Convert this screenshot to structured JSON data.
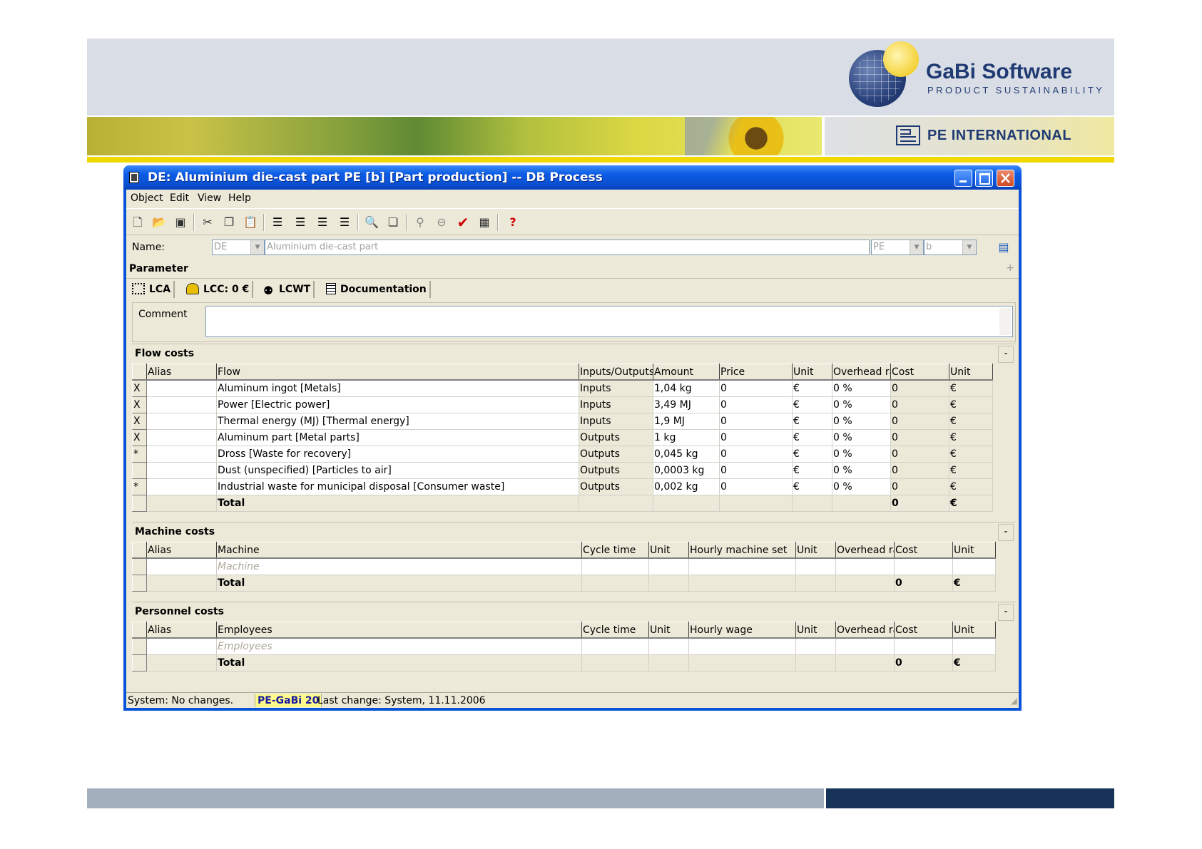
{
  "branding": {
    "logo_title": "GaBi Software",
    "logo_subtitle": "PRODUCT SUSTAINABILITY",
    "company": "PE INTERNATIONAL"
  },
  "window": {
    "title": "DE: Aluminium die-cast part PE [b] [Part production] -- DB Process"
  },
  "menu": {
    "object": "Object",
    "edit": "Edit",
    "view": "View",
    "help": "Help"
  },
  "name_row": {
    "label": "Name:",
    "country": "DE",
    "name": "Aluminium die-cast part",
    "source": "PE",
    "variant": "b"
  },
  "parameter": {
    "label": "Parameter"
  },
  "tabs": {
    "lca": "LCA",
    "lcc": "LCC: 0 €",
    "lcwt": "LCWT",
    "documentation": "Documentation"
  },
  "comment": {
    "label": "Comment",
    "value": ""
  },
  "flow_costs": {
    "title": "Flow costs",
    "headers": [
      "",
      "Alias",
      "Flow",
      "Inputs/Outputs",
      "Amount",
      "Price",
      "Unit",
      "Overhead ra",
      "Cost",
      "Unit"
    ],
    "rows": [
      {
        "mark": "X",
        "alias": "",
        "flow": "Aluminum ingot [Metals]",
        "io": "Inputs",
        "amount": "1,04 kg",
        "price": "0",
        "unit": "€",
        "overhead": "0 %",
        "cost": "0",
        "cost_unit": "€"
      },
      {
        "mark": "X",
        "alias": "",
        "flow": "Power [Electric power]",
        "io": "Inputs",
        "amount": "3,49 MJ",
        "price": "0",
        "unit": "€",
        "overhead": "0 %",
        "cost": "0",
        "cost_unit": "€"
      },
      {
        "mark": "X",
        "alias": "",
        "flow": "Thermal energy (MJ) [Thermal energy]",
        "io": "Inputs",
        "amount": "1,9 MJ",
        "price": "0",
        "unit": "€",
        "overhead": "0 %",
        "cost": "0",
        "cost_unit": "€"
      },
      {
        "mark": "X",
        "alias": "",
        "flow": "Aluminum part [Metal parts]",
        "io": "Outputs",
        "amount": "1 kg",
        "price": "0",
        "unit": "€",
        "overhead": "0 %",
        "cost": "0",
        "cost_unit": "€"
      },
      {
        "mark": "*",
        "alias": "",
        "flow": "Dross [Waste for recovery]",
        "io": "Outputs",
        "amount": "0,045 kg",
        "price": "0",
        "unit": "€",
        "overhead": "0 %",
        "cost": "0",
        "cost_unit": "€"
      },
      {
        "mark": "",
        "alias": "",
        "flow": "Dust (unspecified) [Particles to air]",
        "io": "Outputs",
        "amount": "0,0003 kg",
        "price": "0",
        "unit": "€",
        "overhead": "0 %",
        "cost": "0",
        "cost_unit": "€"
      },
      {
        "mark": "*",
        "alias": "",
        "flow": "Industrial waste for municipal disposal [Consumer waste]",
        "io": "Outputs",
        "amount": "0,002 kg",
        "price": "0",
        "unit": "€",
        "overhead": "0 %",
        "cost": "0",
        "cost_unit": "€"
      }
    ],
    "total": {
      "label": "Total",
      "cost": "0",
      "cost_unit": "€"
    }
  },
  "machine_costs": {
    "title": "Machine costs",
    "headers": [
      "",
      "Alias",
      "Machine",
      "Cycle time",
      "Unit",
      "Hourly machine set",
      "Unit",
      "Overhead ra",
      "Cost",
      "Unit"
    ],
    "placeholder": "Machine",
    "total": {
      "label": "Total",
      "cost": "0",
      "cost_unit": "€"
    }
  },
  "personnel_costs": {
    "title": "Personnel costs",
    "headers": [
      "",
      "Alias",
      "Employees",
      "Cycle time",
      "Unit",
      "Hourly wage",
      "Unit",
      "Overhead ra",
      "Cost",
      "Unit"
    ],
    "placeholder": "Employees",
    "total": {
      "label": "Total",
      "cost": "0",
      "cost_unit": "€"
    }
  },
  "status": {
    "left": "System: No changes.",
    "db": "PE-GaBi 20",
    "last_change": "Last change: System, 11.11.2006"
  }
}
